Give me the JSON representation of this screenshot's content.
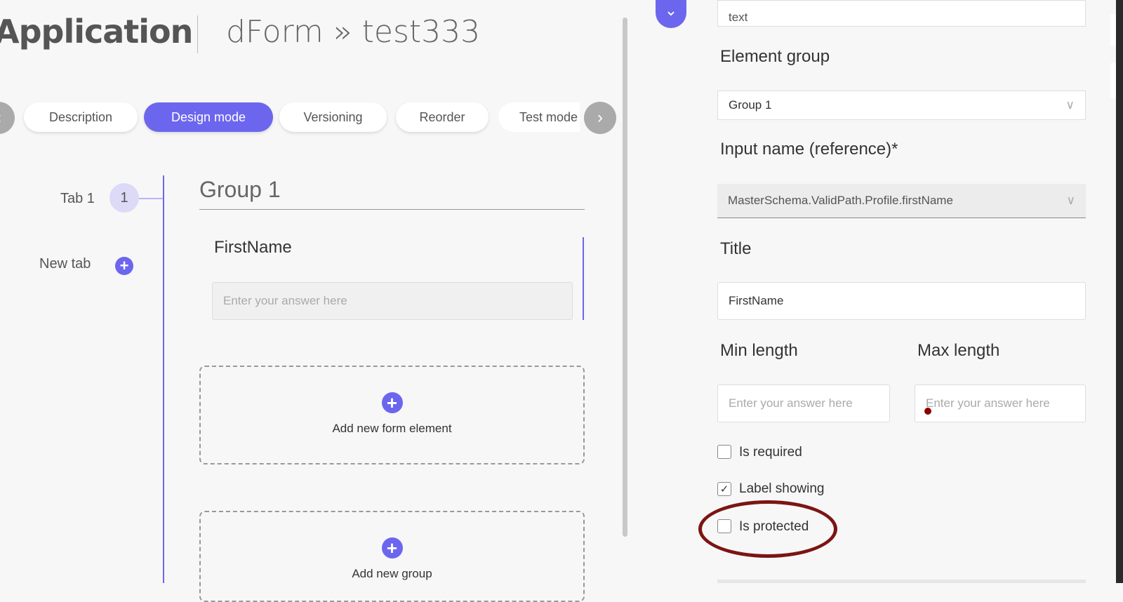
{
  "header": {
    "app_title": "Application",
    "breadcrumb": "dForm » test333"
  },
  "tabs": [
    {
      "label": "Description",
      "active": false
    },
    {
      "label": "Design mode",
      "active": true
    },
    {
      "label": "Versioning",
      "active": false
    },
    {
      "label": "Reorder",
      "active": false
    },
    {
      "label": "Test mode",
      "active": false
    }
  ],
  "nav": {
    "prev_icon": "‹",
    "next_icon": "›"
  },
  "sidebar": {
    "tab_label": "Tab 1",
    "tab_number": "1",
    "new_tab_label": "New tab"
  },
  "canvas": {
    "group_title": "Group 1",
    "field_label": "FirstName",
    "field_placeholder": "Enter your answer here",
    "add_element_label": "Add new form element",
    "add_group_label": "Add new group"
  },
  "panel": {
    "top_value": "text",
    "element_group_label": "Element group",
    "element_group_value": "Group 1",
    "input_name_label": "Input name (reference)*",
    "input_name_value": "MasterSchema.ValidPath.Profile.firstName",
    "title_label": "Title",
    "title_value": "FirstName",
    "min_length_label": "Min length",
    "max_length_label": "Max length",
    "min_placeholder": "Enter your answer here",
    "max_placeholder": "Enter your answer here",
    "checkboxes": [
      {
        "label": "Is required",
        "checked": false
      },
      {
        "label": "Label showing",
        "checked": true
      },
      {
        "label": "Is protected",
        "checked": false
      }
    ]
  },
  "colors": {
    "accent": "#6c66ee",
    "annotation": "#7b1513"
  }
}
